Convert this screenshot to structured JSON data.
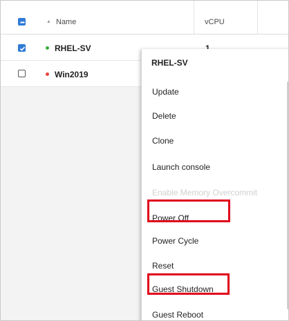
{
  "table": {
    "columns": {
      "name": "Name",
      "vcpu": "vCPU"
    },
    "rows": [
      {
        "name": "RHEL-SV",
        "vcpu": "1",
        "status_color": "#3cb043",
        "selected": true
      },
      {
        "name": "Win2019",
        "vcpu": "",
        "status_color": "#e8453c",
        "selected": false
      }
    ]
  },
  "context_menu": {
    "title": "RHEL-SV",
    "items": [
      {
        "label": "Update",
        "enabled": true,
        "highlighted": false
      },
      {
        "label": "Delete",
        "enabled": true,
        "highlighted": false
      },
      {
        "label": "Clone",
        "enabled": true,
        "highlighted": false
      },
      {
        "label": "Launch console",
        "enabled": true,
        "highlighted": false
      },
      {
        "label": "Enable Memory Overcommit",
        "enabled": false,
        "highlighted": false
      },
      {
        "label": "Power Off",
        "enabled": true,
        "highlighted": true
      },
      {
        "label": "Power Cycle",
        "enabled": true,
        "highlighted": false
      },
      {
        "label": "Reset",
        "enabled": true,
        "highlighted": false
      },
      {
        "label": "Guest Shutdown",
        "enabled": true,
        "highlighted": true
      },
      {
        "label": "Guest Reboot",
        "enabled": true,
        "highlighted": false
      }
    ]
  },
  "colors": {
    "accent": "#2f7bd6",
    "highlight": "#e0001a"
  }
}
